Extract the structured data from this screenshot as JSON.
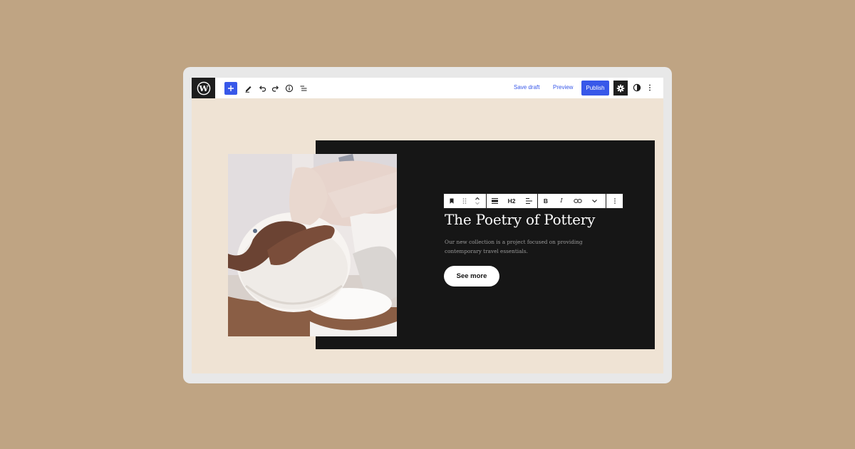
{
  "topbar": {
    "logo_icon": "wordpress-logo-icon",
    "tools": [
      "add-block-icon",
      "edit-pencil-icon",
      "undo-icon",
      "redo-icon",
      "info-icon",
      "list-view-icon"
    ],
    "save_draft_label": "Save draft",
    "preview_label": "Preview",
    "publish_label": "Publish",
    "right_icons": [
      "gear-icon",
      "contrast-icon",
      "more-vertical-icon"
    ]
  },
  "block_toolbar": {
    "items": [
      "bookmark-icon",
      "drag-handle-icon",
      "move-up-down-icon",
      "align-block-icon",
      "H2",
      "text-align-icon",
      "B",
      "I",
      "link-icon",
      "chevron-down-icon",
      "more-vertical-icon"
    ]
  },
  "content": {
    "heading": "The Poetry of Pottery",
    "paragraph": "Our new collection is a project focused on providing contemporary travel essentials.",
    "button_label": "See more"
  },
  "colors": {
    "page_background": "#bfa483",
    "accent": "#3858e9",
    "canvas": "#efe3d4",
    "cover_background": "#161616"
  }
}
